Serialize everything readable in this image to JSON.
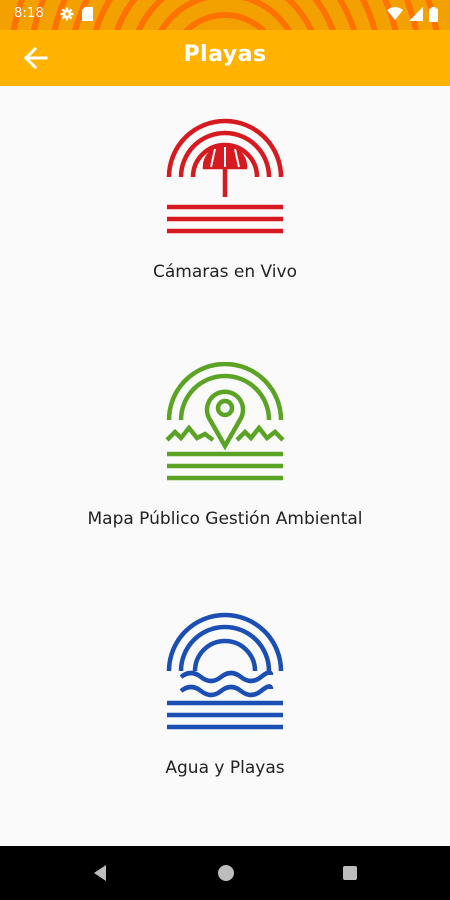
{
  "status_bar": {
    "time": "8:18",
    "left_icons": [
      "gear-icon",
      "sim-card-icon"
    ],
    "right_icons": [
      "wifi-icon",
      "cell-signal-icon",
      "battery-icon"
    ]
  },
  "app_bar": {
    "title": "Playas",
    "back_icon": "arrow-left-icon"
  },
  "menu": {
    "items": [
      {
        "label": "Cámaras en Vivo",
        "icon": "beach-umbrella-icon",
        "color": "#d71920"
      },
      {
        "label": "Mapa Público Gestión Ambiental",
        "icon": "map-pin-landscape-icon",
        "color": "#5ba325"
      },
      {
        "label": "Agua y Playas",
        "icon": "sun-waves-icon",
        "color": "#1b4fb3"
      }
    ]
  },
  "nav_bar": {
    "buttons": [
      "back-triangle-icon",
      "home-circle-icon",
      "recents-square-icon"
    ]
  },
  "colors": {
    "status_bar": "#f3a100",
    "app_bar": "#ffb300",
    "background": "#fafafa"
  }
}
